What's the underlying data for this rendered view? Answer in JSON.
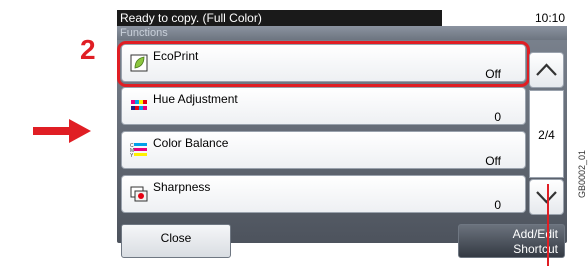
{
  "annotation": {
    "step_number": "2"
  },
  "status": {
    "message": "Ready to copy. (Full Color)",
    "time": "10:10"
  },
  "section": {
    "title": "Functions"
  },
  "functions": [
    {
      "label": "EcoPrint",
      "value": "Off",
      "icon": "ecoprint-leaf-icon"
    },
    {
      "label": "Hue Adjustment",
      "value": "0",
      "icon": "hue-adjustment-icon"
    },
    {
      "label": "Color Balance",
      "value": "Off",
      "icon": "color-balance-icon"
    },
    {
      "label": "Sharpness",
      "value": "0",
      "icon": "sharpness-icon"
    }
  ],
  "pager": {
    "indicator": "2/4",
    "up_icon": "chevron-up-icon",
    "down_icon": "chevron-down-icon"
  },
  "buttons": {
    "close": "Close",
    "add_edit_line1": "Add/Edit",
    "add_edit_line2": "Shortcut"
  },
  "image_code": "GB0002_01",
  "colors": {
    "highlight": "#e01e24",
    "arrow": "#e01e24"
  }
}
